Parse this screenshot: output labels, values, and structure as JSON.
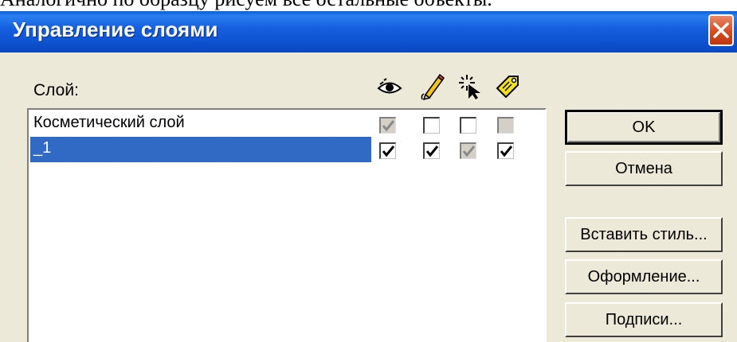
{
  "header_text": "Аналогично по образцу рисуем все остальные объекты.",
  "window": {
    "title": "Управление слоями"
  },
  "layer_label": "Слой:",
  "columns": [
    {
      "icon": "eye-icon"
    },
    {
      "icon": "pencil-icon"
    },
    {
      "icon": "select-cursor-icon"
    },
    {
      "icon": "label-tag-icon"
    }
  ],
  "layers": [
    {
      "name": "Косметический слой",
      "selected": false,
      "flags": [
        {
          "checked": true,
          "disabled": true
        },
        {
          "checked": false,
          "disabled": false
        },
        {
          "checked": false,
          "disabled": false
        },
        {
          "checked": false,
          "disabled": true
        }
      ]
    },
    {
      "name": "_1",
      "selected": true,
      "flags": [
        {
          "checked": true,
          "disabled": false
        },
        {
          "checked": true,
          "disabled": false
        },
        {
          "checked": true,
          "disabled": true
        },
        {
          "checked": true,
          "disabled": false
        }
      ]
    }
  ],
  "buttons": {
    "ok": "OK",
    "cancel": "Отмена",
    "insert_style": "Вставить стиль...",
    "design": "Оформление...",
    "captions": "Подписи..."
  },
  "colors": {
    "selection": "#316ac5",
    "titlebar": "#0d52d0",
    "dialog_bg": "#ece9d8"
  }
}
